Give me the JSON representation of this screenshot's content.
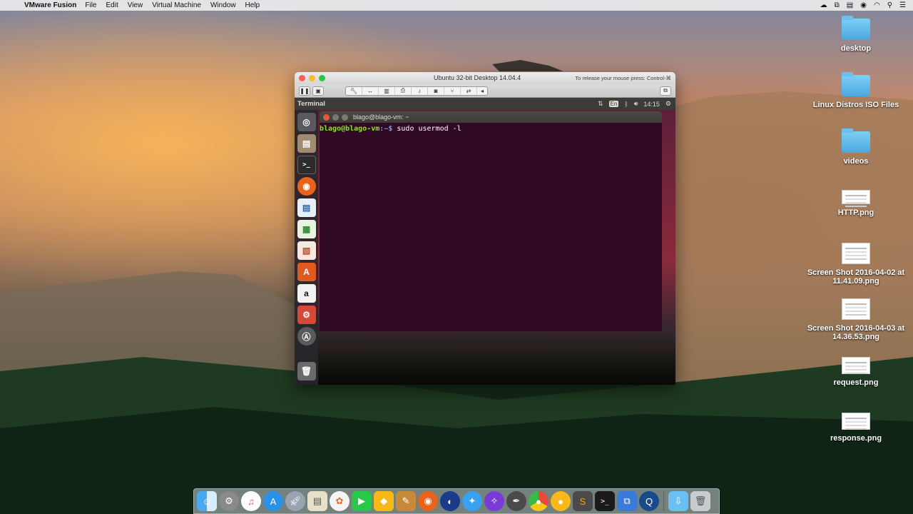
{
  "menubar": {
    "app_name": "VMware Fusion",
    "items": [
      "File",
      "Edit",
      "View",
      "Virtual Machine",
      "Window",
      "Help"
    ]
  },
  "vm_window": {
    "title": "Ubuntu 32-bit Desktop 14.04.4",
    "release_hint": "To release your mouse press: Control-⌘"
  },
  "ubuntu_panel": {
    "app_title": "Terminal",
    "keyboard_layout": "En",
    "clock": "14:15"
  },
  "terminal": {
    "window_title": "blago@blago-vm: ~",
    "prompt_user": "blago@blago-vm",
    "prompt_path": ":~$",
    "command": " sudo usermod -l"
  },
  "desktop_items": [
    {
      "label": "desktop",
      "kind": "folder"
    },
    {
      "label": "Linux Distros ISO Files",
      "kind": "folder"
    },
    {
      "label": "videos",
      "kind": "folder"
    },
    {
      "label": "HTTP.png",
      "kind": "image"
    },
    {
      "label": "Screen Shot 2016-04-02 at 11.41.09.png",
      "kind": "image"
    },
    {
      "label": "Screen Shot 2016-04-03 at 14.36.53.png",
      "kind": "image"
    },
    {
      "label": "request.png",
      "kind": "image"
    },
    {
      "label": "response.png",
      "kind": "image"
    }
  ],
  "colors": {
    "terminal_bg": "#300a24",
    "prompt_user": "#8ae234",
    "prompt_path": "#729fcf",
    "ubuntu_panel": "#3c3b37"
  },
  "icons": {
    "launcher": [
      "ubuntu-dash-icon",
      "files-icon",
      "terminal-icon",
      "firefox-icon",
      "writer-icon",
      "calc-icon",
      "impress-icon",
      "software-center-icon",
      "amazon-icon",
      "settings-icon",
      "updater-icon",
      "trash-icon"
    ],
    "dock": [
      "finder-icon",
      "system-prefs-icon",
      "itunes-icon",
      "app-store-icon",
      "launchpad-icon",
      "preview-icon",
      "photos-icon",
      "facetime-icon",
      "sketch-icon",
      "notes-icon",
      "firefox-icon",
      "world-icon",
      "safari-icon",
      "compass-icon",
      "pen-icon",
      "chrome-icon",
      "canary-icon",
      "sublime-icon",
      "terminal-icon",
      "vmware-icon",
      "quicktime-icon",
      "downloads-folder-icon",
      "trash-icon"
    ]
  }
}
